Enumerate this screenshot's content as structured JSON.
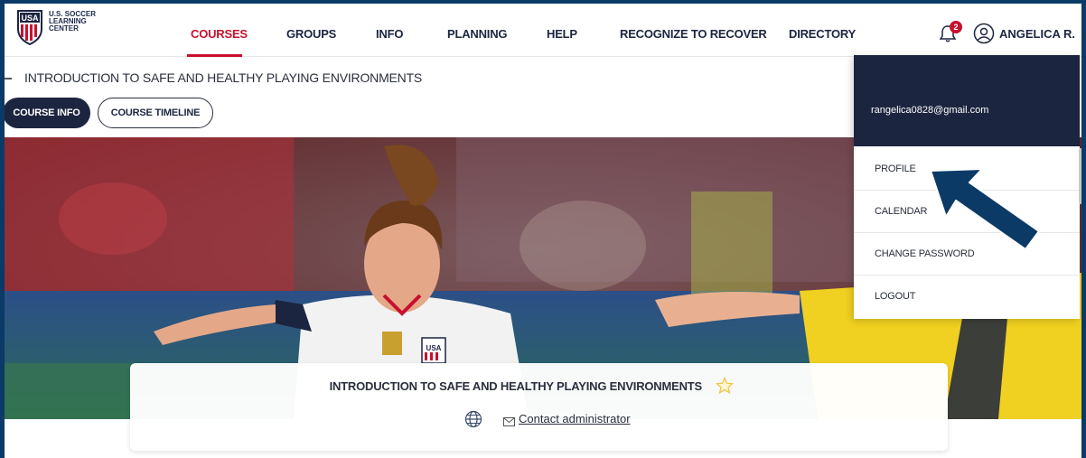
{
  "brand": {
    "crest_letters": "USA",
    "logo_text_line1": "U.S. SOCCER",
    "logo_text_line2": "LEARNING",
    "logo_text_line3": "CENTER",
    "red": "#c8102e",
    "navy": "#1c2540"
  },
  "nav": {
    "items": [
      {
        "label": "COURSES",
        "active": true
      },
      {
        "label": "GROUPS"
      },
      {
        "label": "INFO"
      },
      {
        "label": "PLANNING"
      },
      {
        "label": "HELP"
      },
      {
        "label": "RECOGNIZE TO RECOVER"
      },
      {
        "label": "DIRECTORY"
      }
    ],
    "notification_count": "2",
    "user_name": "ANGELICA R."
  },
  "page": {
    "title": "INTRODUCTION TO SAFE AND HEALTHY PLAYING ENVIRONMENTS",
    "tabs": [
      {
        "label": "COURSE INFO",
        "active": true
      },
      {
        "label": "COURSE TIMELINE"
      }
    ]
  },
  "card": {
    "title": "INTRODUCTION TO SAFE AND HEALTHY PLAYING ENVIRONMENTS",
    "contact_label": "Contact administrator"
  },
  "dropdown": {
    "email": "rangelica0828@gmail.com",
    "items": [
      {
        "label": "PROFILE"
      },
      {
        "label": "CALENDAR"
      },
      {
        "label": "CHANGE PASSWORD"
      },
      {
        "label": "LOGOUT"
      }
    ]
  },
  "hero": {
    "jersey_crest": "USA"
  }
}
